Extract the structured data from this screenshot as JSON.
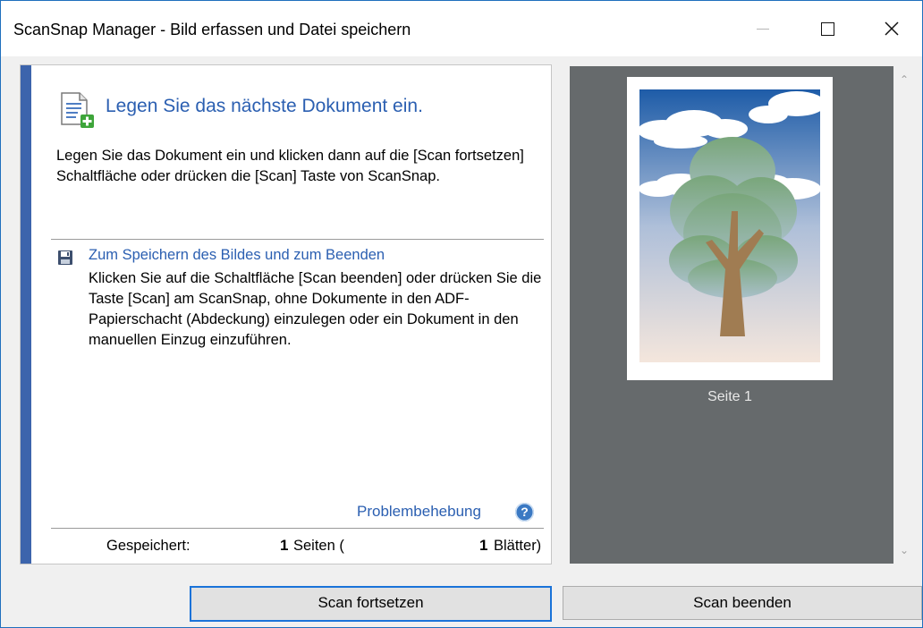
{
  "window": {
    "title": "ScanSnap Manager - Bild erfassen und Datei speichern"
  },
  "instructions": {
    "heading": "Legen Sie das nächste Dokument ein.",
    "body": "Legen Sie das Dokument ein und klicken dann auf die [Scan fortsetzen] Schaltfläche oder drücken die [Scan] Taste von ScanSnap."
  },
  "save_section": {
    "heading": "Zum Speichern des Bildes und zum Beenden",
    "body": "Klicken Sie auf die Schaltfläche [Scan beenden] oder drücken Sie die Taste [Scan] am ScanSnap, ohne Dokumente in den ADF-Papierschacht (Abdeckung) einzulegen oder ein Dokument in den manuellen Einzug einzuführen."
  },
  "troubleshooting": {
    "link": "Problembehebung"
  },
  "status": {
    "label": "Gespeichert:",
    "pages_count": "1",
    "pages_unit": "Seiten (",
    "sheets_count": "1",
    "sheets_unit": "Blätter)"
  },
  "preview": {
    "page_label": "Seite 1"
  },
  "buttons": {
    "continue": "Scan fortsetzen",
    "end": "Scan beenden"
  },
  "colors": {
    "accent": "#3c64ac",
    "link": "#2b5fb1",
    "focus_border": "#1a73d9",
    "preview_bg": "#666a6c"
  }
}
